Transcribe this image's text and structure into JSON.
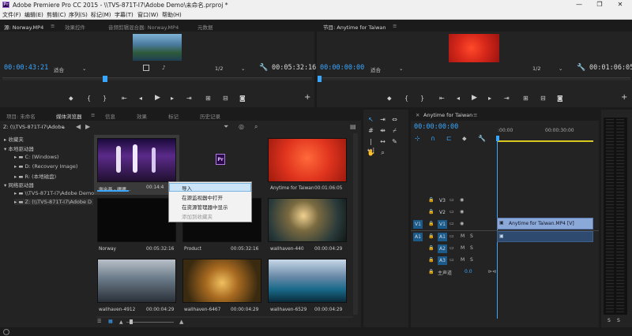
{
  "app": {
    "title": "Adobe Premiere Pro CC 2015 - \\\\TVS-871T-I7\\Adobe Demo\\未命名.prproj *",
    "logo": "Pr"
  },
  "menu": [
    "文件(F)",
    "编辑(E)",
    "剪辑(C)",
    "序列(S)",
    "标记(M)",
    "字幕(T)",
    "窗口(W)",
    "帮助(H)"
  ],
  "source_panel": {
    "tabs": [
      "源: Norway.MP4",
      "效果控件",
      "音频剪辑混合器: Norway.MP4",
      "元数据"
    ],
    "timecode_in": "00:00:43:21",
    "fit": "适合",
    "resolution": "1/2",
    "timecode_out": "00:05:32:16"
  },
  "program_panel": {
    "tab": "节目: Anytime for Taiwan",
    "timecode_in": "00:00:00:00",
    "fit": "适合",
    "resolution": "1/2",
    "timecode_out": "00:01:06:05"
  },
  "project_panel": {
    "tabs": [
      "项目: 未命名",
      "媒体浏览器",
      "信息",
      "效果",
      "标记",
      "历史记录"
    ],
    "path": "Z: (\\\\TVS-871T-I7\\Adobe",
    "tree": [
      "收藏夹",
      "本地驱动器",
      "C: (Windows)",
      "D: (Recovery Image)",
      "R: (本地磁盘)",
      "网络驱动器",
      "\\\\TVS-871T-I7\\Adobe Demo",
      "Z: (\\\\TVS-871T-I7\\Adobe D"
    ]
  },
  "media": [
    {
      "name": "謝金燕 - 嗶嗶...",
      "duration": "00:14:4"
    },
    {
      "name": "",
      "duration": ""
    },
    {
      "name": "Anytime for Taiwan",
      "duration": "00:01:06:05"
    },
    {
      "name": "Norway",
      "duration": "00:05:32:16"
    },
    {
      "name": "Product",
      "duration": "00:05:32:16"
    },
    {
      "name": "wallhaven-440",
      "duration": "00:00:04:29"
    },
    {
      "name": "wallhaven-4912",
      "duration": "00:00:04:29"
    },
    {
      "name": "wallhaven-6467",
      "duration": "00:00:04:29"
    },
    {
      "name": "wallhaven-6529",
      "duration": "00:00:04:29"
    }
  ],
  "context_menu": [
    "导入",
    "在源监视器中打开",
    "在资源管理器中显示",
    "添加到收藏夹"
  ],
  "timeline": {
    "tab": "Anytime for Taiwan",
    "timecode": "00:00:00:00",
    "ruler": [
      ":00:00",
      "00:00:30:00"
    ],
    "video_tracks": [
      "V3",
      "V2",
      "V1"
    ],
    "audio_tracks": [
      "A1",
      "A2",
      "A3"
    ],
    "source_v": "V1",
    "source_a": "A1",
    "master": "主声道",
    "master_value": "0.0",
    "clip_name": "Anytime for Taiwan.MP4 [V]",
    "m_label": "M",
    "s_label": "S"
  },
  "meters": {
    "labels": [
      "S",
      "S"
    ]
  },
  "icons": {
    "pr_file": "Pr"
  }
}
